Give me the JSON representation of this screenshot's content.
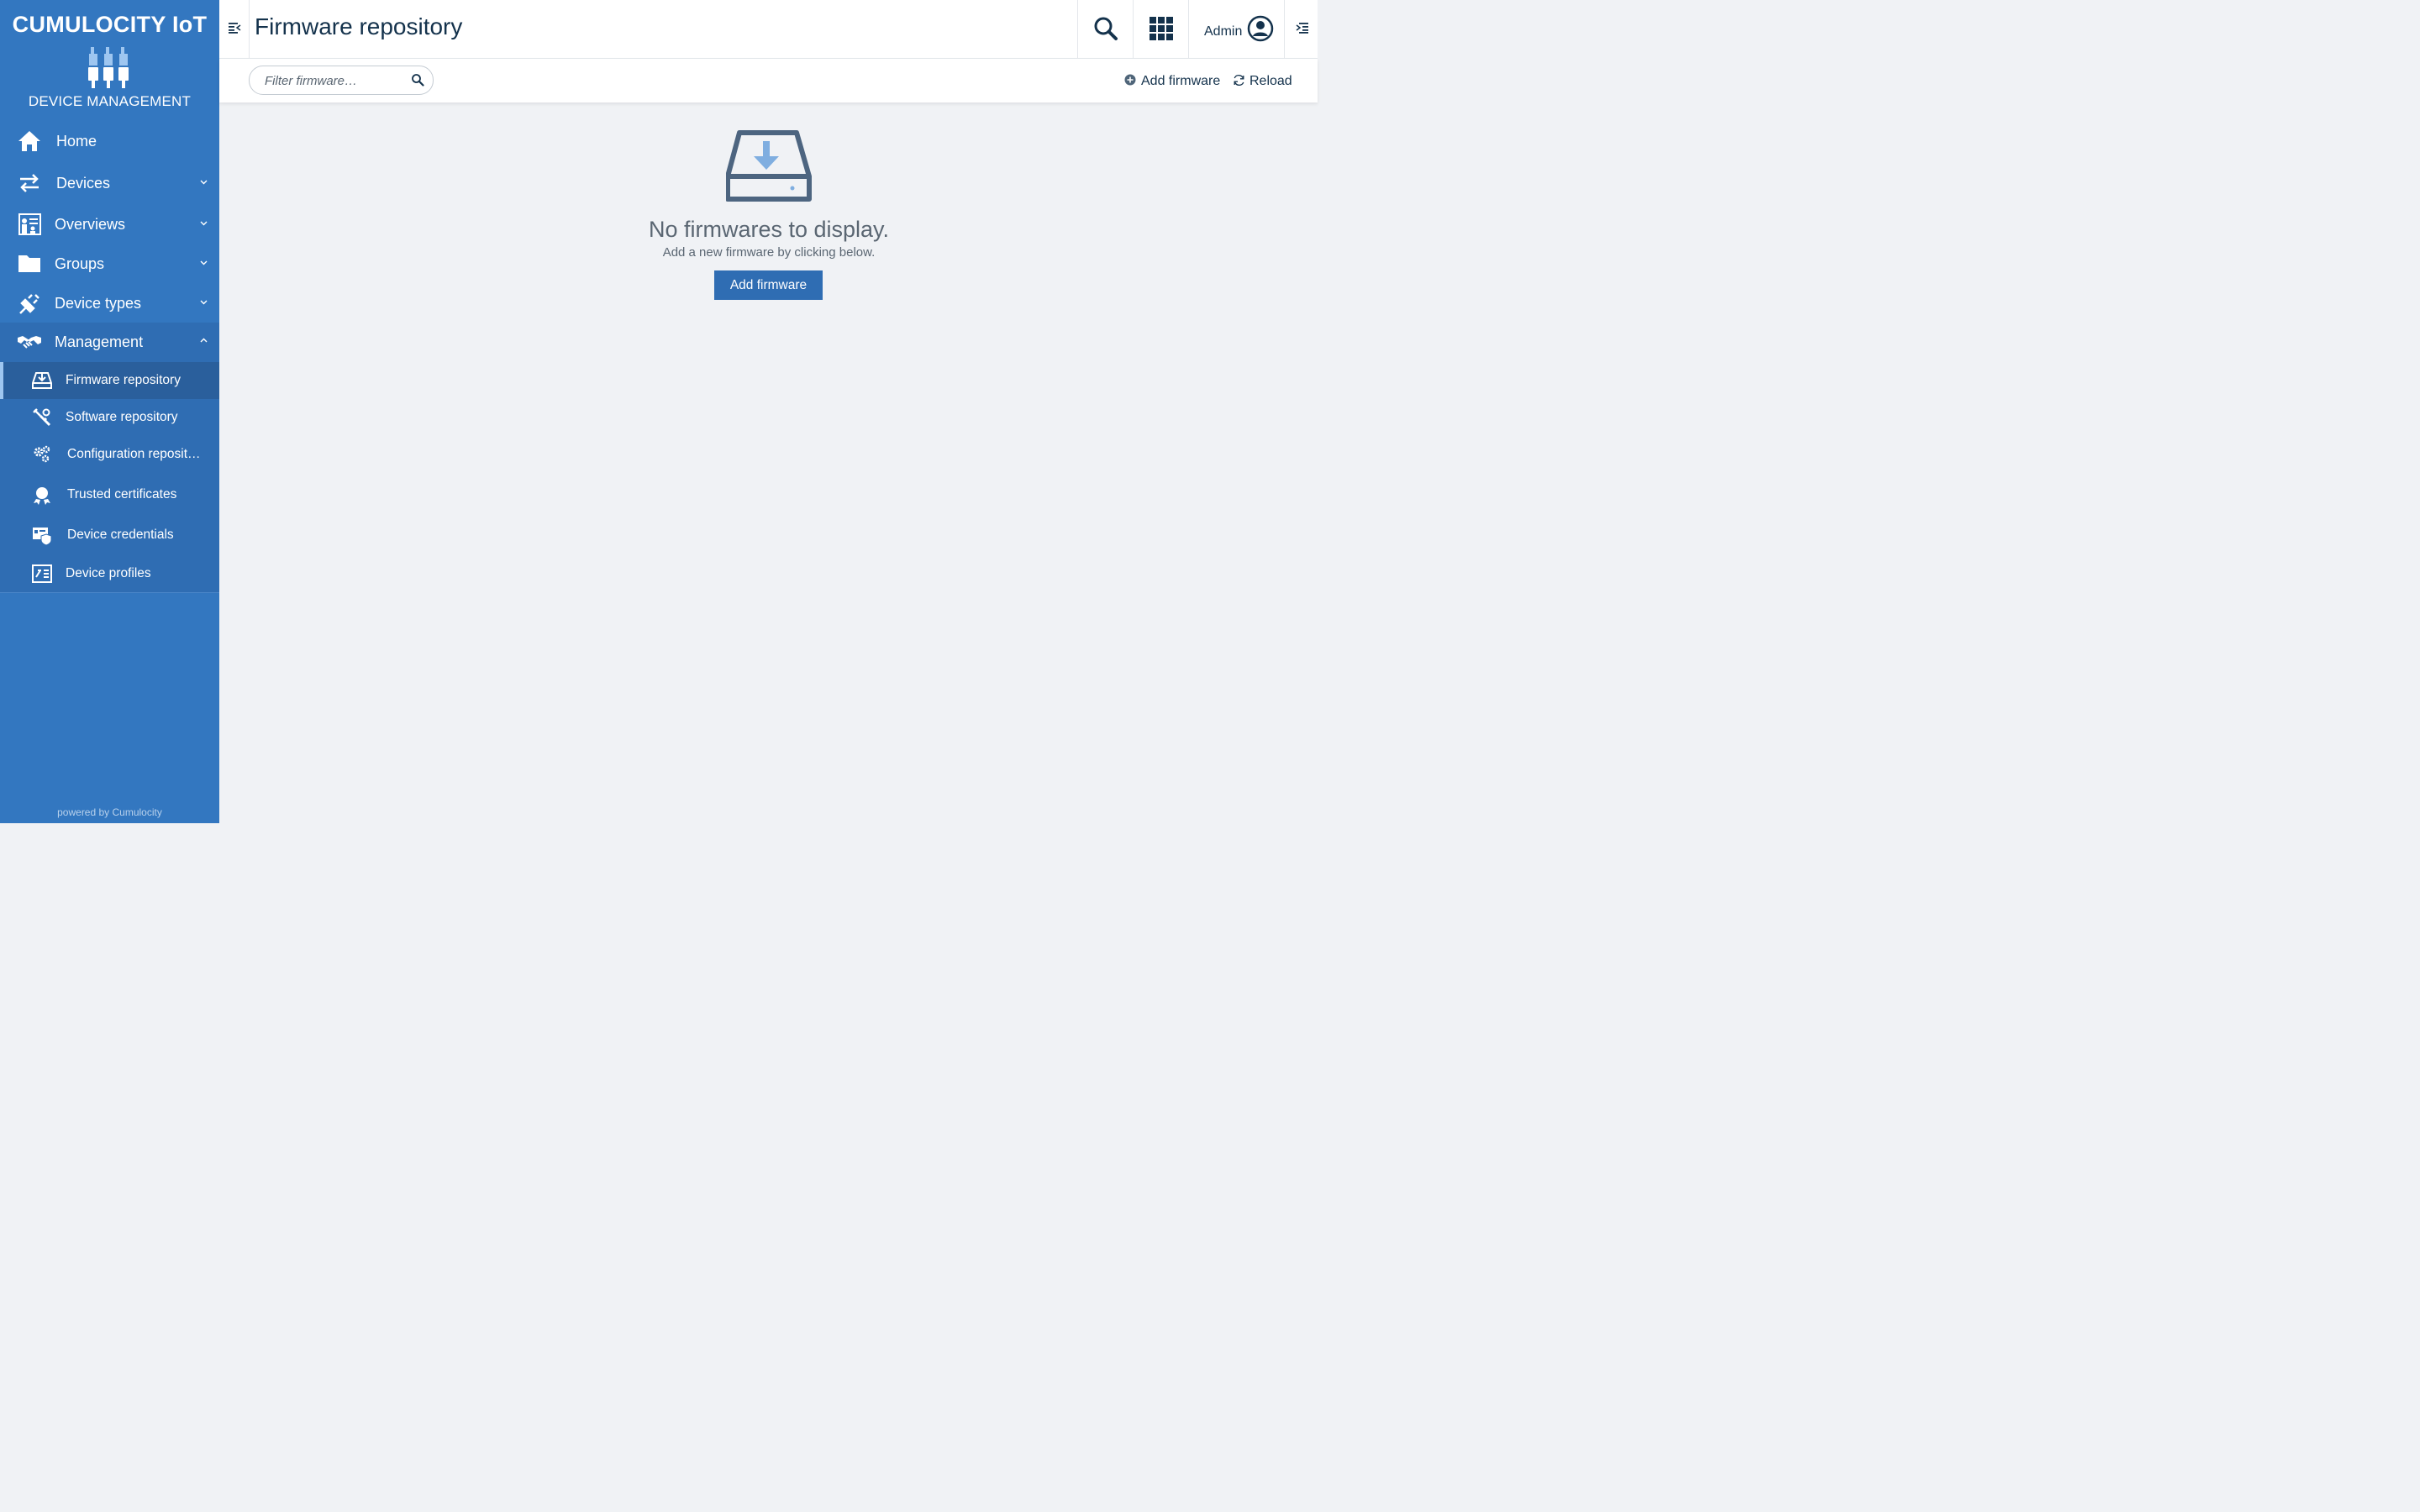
{
  "brand": {
    "title": "CUMULOCITY IoT",
    "subtitle": "DEVICE MANAGEMENT",
    "powered_by": "powered by Cumulocity"
  },
  "colors": {
    "sidebar_bg": "#3377c0",
    "sidebar_active": "#2a5f9c",
    "primary_button": "#2f6db3",
    "page_bg": "#f0f2f5",
    "text_dark": "#14324c"
  },
  "sidebar": {
    "items": [
      {
        "label": "Home",
        "icon": "home-icon",
        "expandable": false
      },
      {
        "label": "Devices",
        "icon": "exchange-arrows-icon",
        "expandable": true
      },
      {
        "label": "Overviews",
        "icon": "dashboard-presentation-icon",
        "expandable": true
      },
      {
        "label": "Groups",
        "icon": "folder-icon",
        "expandable": true
      },
      {
        "label": "Device types",
        "icon": "plug-icon",
        "expandable": true
      },
      {
        "label": "Management",
        "icon": "handshake-icon",
        "expandable": true,
        "expanded": true
      }
    ],
    "management_children": [
      {
        "label": "Firmware repository",
        "icon": "hard-drive-download-icon",
        "active": true
      },
      {
        "label": "Software repository",
        "icon": "software-tools-icon",
        "active": false
      },
      {
        "label": "Configuration reposit…",
        "icon": "gears-icon",
        "active": false
      },
      {
        "label": "Trusted certificates",
        "icon": "certificate-icon",
        "active": false
      },
      {
        "label": "Device credentials",
        "icon": "credentials-shield-icon",
        "active": false
      },
      {
        "label": "Device profiles",
        "icon": "device-profile-icon",
        "active": false
      }
    ]
  },
  "header": {
    "title": "Firmware repository",
    "user_name": "Admin"
  },
  "actionbar": {
    "filter_placeholder": "Filter firmware…",
    "add_label": "Add firmware",
    "reload_label": "Reload"
  },
  "empty_state": {
    "title": "No firmwares to display.",
    "subtitle": "Add a new firmware by clicking below.",
    "button_label": "Add firmware"
  }
}
